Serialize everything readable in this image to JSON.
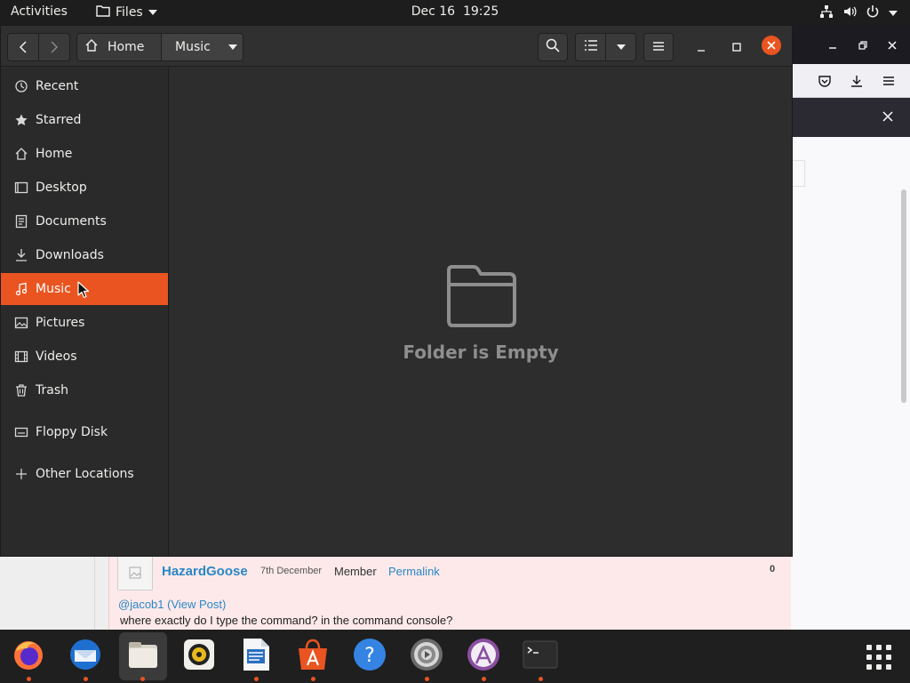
{
  "topbar": {
    "activities": "Activities",
    "app_name": "Files",
    "date": "Dec 16",
    "time": "19:25"
  },
  "files_window": {
    "path": {
      "home": "Home",
      "current": "Music"
    },
    "sidebar": [
      {
        "label": "Recent",
        "icon": "clock-icon"
      },
      {
        "label": "Starred",
        "icon": "star-icon"
      },
      {
        "label": "Home",
        "icon": "home-icon"
      },
      {
        "label": "Desktop",
        "icon": "desktop-icon"
      },
      {
        "label": "Documents",
        "icon": "document-icon"
      },
      {
        "label": "Downloads",
        "icon": "download-icon"
      },
      {
        "label": "Music",
        "icon": "music-icon",
        "active": true
      },
      {
        "label": "Pictures",
        "icon": "picture-icon"
      },
      {
        "label": "Videos",
        "icon": "film-icon"
      },
      {
        "label": "Trash",
        "icon": "trash-icon"
      },
      {
        "label": "Floppy Disk",
        "icon": "drive-icon"
      },
      {
        "label": "Other Locations",
        "icon": "plus-icon"
      }
    ],
    "empty_message": "Folder is Empty"
  },
  "webpage": {
    "post": {
      "username": "HazardGoose",
      "date": "7th December",
      "role": "Member",
      "permalink": "Permalink",
      "votes": "0",
      "reply_to": "@jacob1 (View Post)",
      "text": "where exactly do I type the command? in the command console?"
    }
  },
  "dock": [
    {
      "name": "Firefox",
      "icon": "firefox-icon",
      "running": true
    },
    {
      "name": "Thunderbird",
      "icon": "thunderbird-icon",
      "running": true
    },
    {
      "name": "Files",
      "icon": "files-icon",
      "running": true,
      "active": true
    },
    {
      "name": "Rhythmbox",
      "icon": "rhythmbox-icon",
      "running": false
    },
    {
      "name": "LibreOffice Writer",
      "icon": "writer-icon",
      "running": true
    },
    {
      "name": "Ubuntu Software",
      "icon": "software-icon",
      "running": true
    },
    {
      "name": "Help",
      "icon": "help-icon",
      "running": false
    },
    {
      "name": "Settings",
      "icon": "settings-icon",
      "running": true
    },
    {
      "name": "App Center",
      "icon": "appcenter-icon",
      "running": true
    },
    {
      "name": "Terminal",
      "icon": "terminal-icon",
      "running": true
    }
  ],
  "colors": {
    "accent": "#e95420",
    "window_bg": "#2d2d2d",
    "sidebar_bg": "#2a2a2a",
    "topbar_bg": "#1d1d1d"
  }
}
